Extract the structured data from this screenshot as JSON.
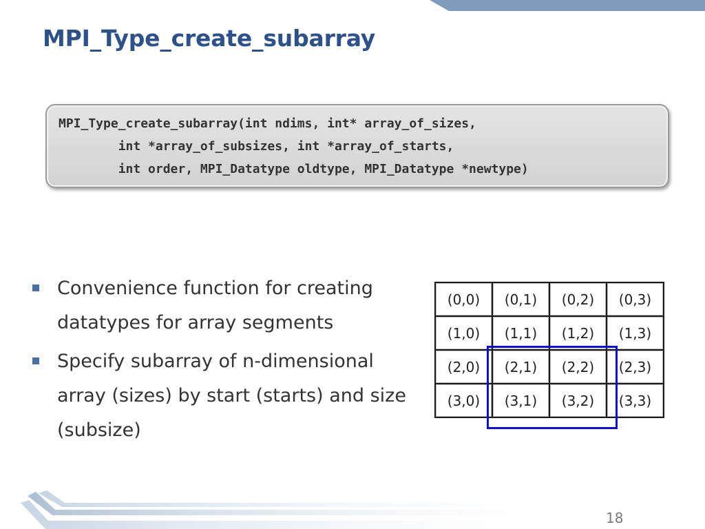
{
  "slide": {
    "title": "MPI_Type_create_subarray",
    "code_lines": [
      "MPI_Type_create_subarray(int ndims, int* array_of_sizes,",
      "        int *array_of_subsizes, int *array_of_starts,",
      "        int order, MPI_Datatype oldtype, MPI_Datatype *newtype)"
    ],
    "bullets": [
      "Convenience function for creating datatypes for array segments",
      "Specify subarray of n-dimensional array (sizes) by start (starts) and size (subsize)"
    ],
    "grid": [
      [
        "(0,0)",
        "(0,1)",
        "(0,2)",
        "(0,3)"
      ],
      [
        "(1,0)",
        "(1,1)",
        "(1,2)",
        "(1,3)"
      ],
      [
        "(2,0)",
        "(2,1)",
        "(2,2)",
        "(2,3)"
      ],
      [
        "(3,0)",
        "(3,1)",
        "(3,2)",
        "(3,3)"
      ]
    ],
    "page_number": "18"
  },
  "colors": {
    "title": "#2e5287",
    "bullet_icon": "#4a6fa5",
    "highlight": "#1010c8",
    "code_box": "#d9d9d9",
    "top_band": "#7f9cbc"
  },
  "icons": {
    "bullet": "square-bullet-icon"
  }
}
